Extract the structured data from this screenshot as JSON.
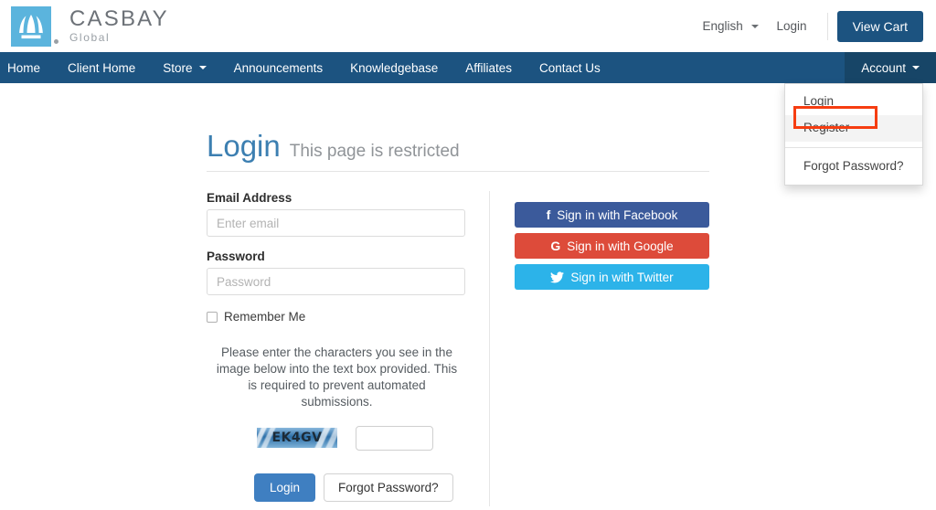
{
  "brand": {
    "name": "CASBAY",
    "tagline": "Global",
    "logo_icon": "crown-fountain-logo",
    "logo_color": "#5bb4dd"
  },
  "header": {
    "language_label": "English",
    "login_label": "Login",
    "cart_label": "View Cart",
    "cart_color": "#1c5380"
  },
  "nav": {
    "background": "#1c5380",
    "items": [
      {
        "label": "Home",
        "caret": false
      },
      {
        "label": "Client Home",
        "caret": false
      },
      {
        "label": "Store",
        "caret": true
      },
      {
        "label": "Announcements",
        "caret": false
      },
      {
        "label": "Knowledgebase",
        "caret": false
      },
      {
        "label": "Affiliates",
        "caret": false
      },
      {
        "label": "Contact Us",
        "caret": false
      }
    ],
    "account_label": "Account"
  },
  "dropdown": {
    "items": [
      {
        "label": "Login",
        "hover": false
      },
      {
        "label": "Register",
        "hover": true
      },
      {
        "label": "Forgot Password?",
        "hover": false
      }
    ],
    "highlight_target": "Register",
    "highlight_color": "#f63d11"
  },
  "page": {
    "title": "Login",
    "subtitle": "This page is restricted",
    "title_color": "#3c7fb1"
  },
  "form": {
    "email_label": "Email Address",
    "email_value": "",
    "email_placeholder": "Enter email",
    "password_label": "Password",
    "password_value": "",
    "password_placeholder": "Password",
    "remember_label": "Remember Me",
    "remember_checked": false,
    "captcha_note": "Please enter the characters you see in the image below into the text box provided. This is required to prevent automated submissions.",
    "captcha_code": "EK4GV",
    "captcha_input_value": "",
    "login_button": "Login",
    "forgot_button": "Forgot Password?",
    "login_button_color": "#3f7fc1"
  },
  "social": {
    "buttons": [
      {
        "label": "Sign in with Facebook",
        "icon": "facebook-icon",
        "glyph": "f",
        "color": "#3b5a9b"
      },
      {
        "label": "Sign in with Google",
        "icon": "google-icon",
        "glyph": "G",
        "color": "#dd4b3a"
      },
      {
        "label": "Sign in with Twitter",
        "icon": "twitter-icon",
        "glyph": "ᴠ",
        "color": "#2cb3e9"
      }
    ]
  }
}
